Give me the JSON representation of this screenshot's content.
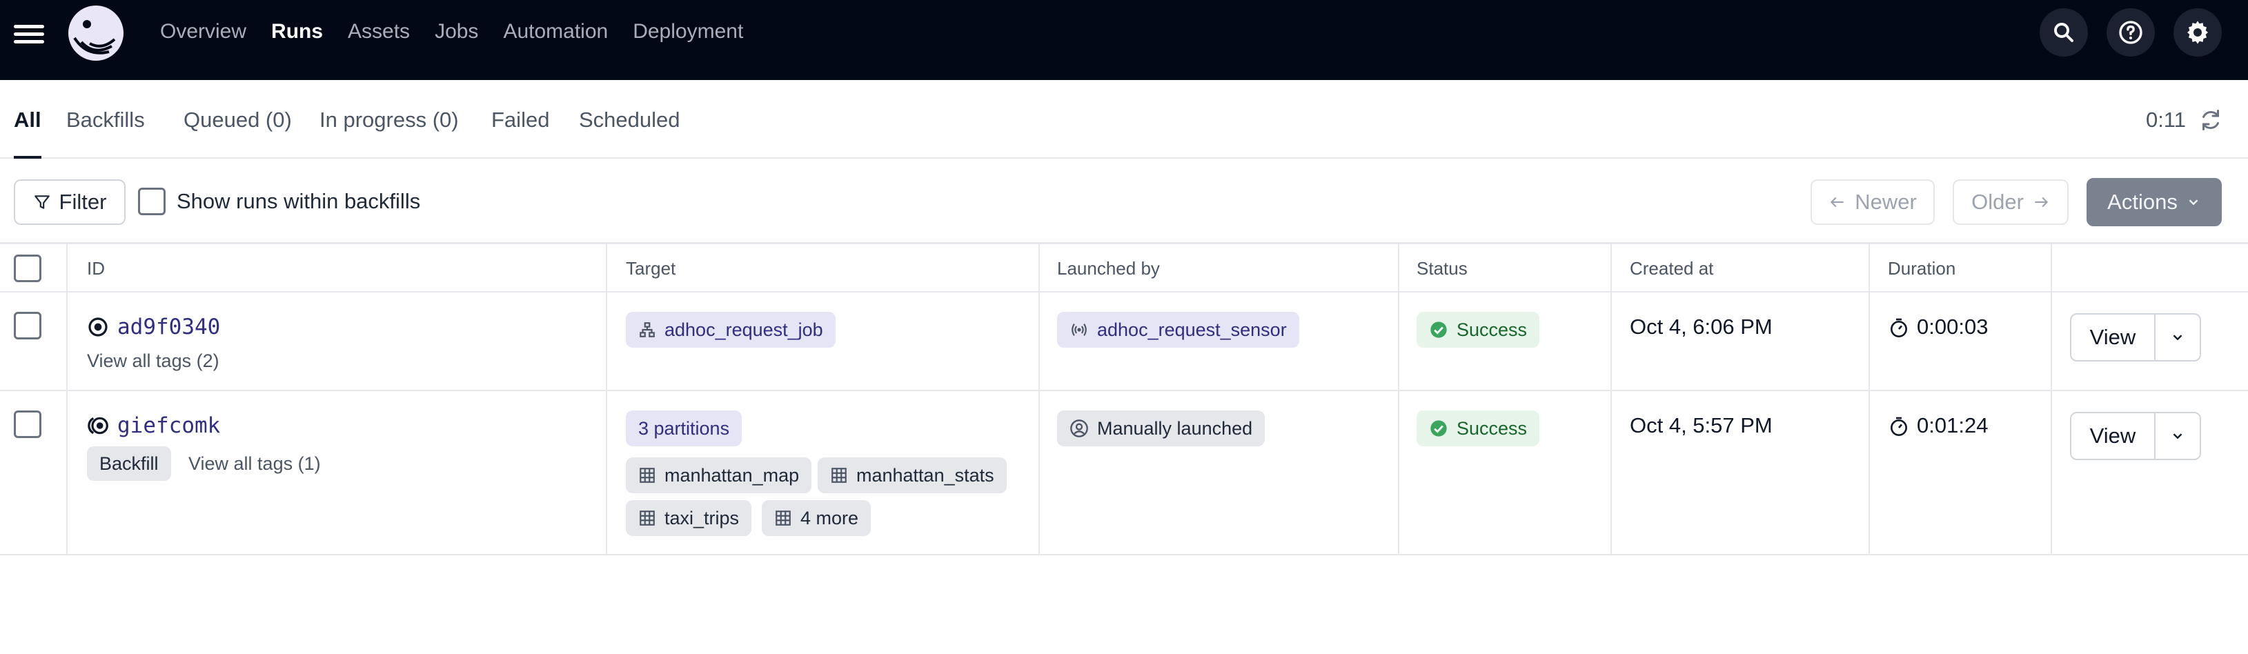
{
  "nav": {
    "links": [
      "Overview",
      "Runs",
      "Assets",
      "Jobs",
      "Automation",
      "Deployment"
    ],
    "active": "Runs"
  },
  "tabs": {
    "items": [
      "All",
      "Backfills",
      "Queued (0)",
      "In progress (0)",
      "Failed",
      "Scheduled"
    ],
    "active": "All",
    "timer": "0:11"
  },
  "filters": {
    "filter_label": "Filter",
    "show_backfills_label": "Show runs within backfills",
    "newer_label": "Newer",
    "older_label": "Older",
    "actions_label": "Actions"
  },
  "table": {
    "headers": [
      "ID",
      "Target",
      "Launched by",
      "Status",
      "Created at",
      "Duration"
    ],
    "rows": [
      {
        "id": "ad9f0340",
        "tags_link": "View all tags (2)",
        "target": "adhoc_request_job",
        "launched_by": "adhoc_request_sensor",
        "status": "Success",
        "created_at": "Oct 4, 6:06 PM",
        "duration": "0:00:03",
        "view_label": "View"
      },
      {
        "id": "giefcomk",
        "backfill_tag": "Backfill",
        "tags_link": "View all tags (1)",
        "partitions": "3 partitions",
        "assets": [
          "manhattan_map",
          "manhattan_stats",
          "taxi_trips",
          "4 more"
        ],
        "launched_by": "Manually launched",
        "status": "Success",
        "created_at": "Oct 4, 5:57 PM",
        "duration": "0:01:24",
        "view_label": "View"
      }
    ]
  },
  "colors": {
    "nav_bg": "#030816",
    "success": "#3aa55d",
    "accent": "#312e81"
  }
}
